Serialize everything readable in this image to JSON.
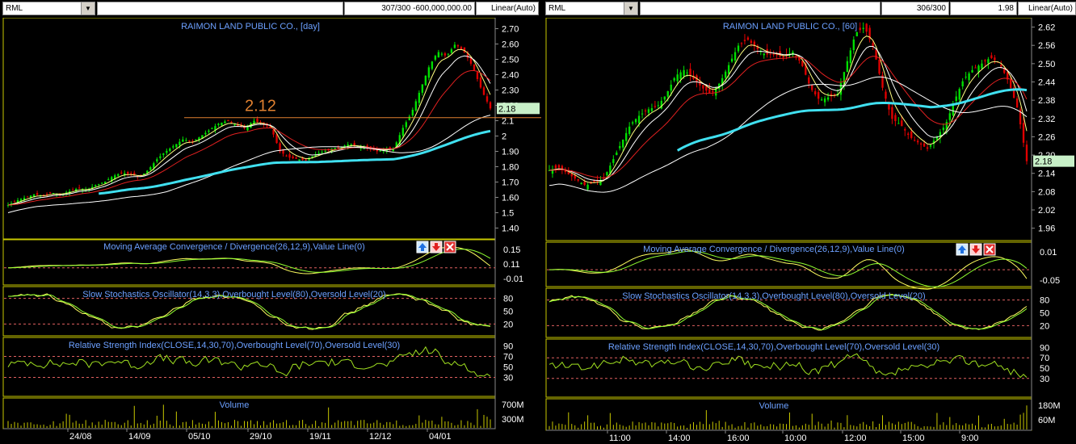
{
  "left": {
    "symbol": "RML",
    "field1": "",
    "field2": "307/300 -600,000,000.00",
    "scale": "Linear(Auto)",
    "title": "RAIMON LAND PUBLIC CO., [day]",
    "price_label": "2.18",
    "annotation": "2.12",
    "y_ticks": [
      "2.70",
      "2.60",
      "2.50",
      "2.40",
      "2.30",
      "2.20",
      "2.1",
      "2",
      "1.90",
      "1.80",
      "1.70",
      "1.60",
      "1.5",
      "1.40"
    ],
    "macd_title": "Moving Average Convergence / Divergence(26,12,9),Value Line(0)",
    "macd_ticks": [
      "0.15",
      "0.11",
      "-0.01"
    ],
    "stoch_title": "Slow Stochastics Oscillator(14,3,3),Overbought Level(80),Oversold Level(20)",
    "stoch_ticks": [
      "80",
      "50",
      "20"
    ],
    "rsi_title": "Relative Strength Index(CLOSE,14,30,70),Overbought Level(70),Oversold Level(30)",
    "rsi_ticks": [
      "90",
      "70",
      "50",
      "30"
    ],
    "volume_title": "Volume",
    "volume_ticks": [
      "700M",
      "300M"
    ],
    "x_ticks": [
      "24/08",
      "14/09",
      "05/10",
      "29/10",
      "19/11",
      "12/12",
      "04/01"
    ]
  },
  "right": {
    "symbol": "RML",
    "field1": "",
    "field2": "306/300",
    "field3": "1.98",
    "scale": "Linear(Auto)",
    "title": "RAIMON LAND PUBLIC CO., [60]",
    "price_label": "2.18",
    "y_ticks": [
      "2.62",
      "2.56",
      "2.50",
      "2.44",
      "2.38",
      "2.32",
      "2.26",
      "2.20",
      "2.14",
      "2.08",
      "2.02",
      "1.96"
    ],
    "macd_title": "Moving Average Convergence / Divergence(26,12,9),Value Line(0)",
    "macd_ticks": [
      "0.01",
      "-0.05"
    ],
    "stoch_title": "Slow Stochastics Oscillator(14,3,3),Overbought Level(80),Oversold Level(20)",
    "stoch_ticks": [
      "80",
      "50",
      "20"
    ],
    "rsi_title": "Relative Strength Index(CLOSE,14,30,70),Overbought Level(70),Oversold Level(30)",
    "rsi_ticks": [
      "90",
      "70",
      "50",
      "30"
    ],
    "volume_title": "Volume",
    "volume_ticks": [
      "180M",
      "60M"
    ],
    "x_ticks": [
      "11:00",
      "14:00",
      "16:00",
      "10:00",
      "12:00",
      "15:00",
      "9:00"
    ]
  },
  "chart_data": [
    {
      "type": "candlestick",
      "title": "RAIMON LAND PUBLIC CO., [day]",
      "y_range": [
        1.35,
        2.75
      ],
      "last_price": 2.18,
      "annotation_level": 2.12,
      "x_labels": [
        "24/08",
        "14/09",
        "05/10",
        "29/10",
        "19/11",
        "12/12",
        "04/01"
      ],
      "close_series": [
        1.55,
        1.58,
        1.6,
        1.62,
        1.61,
        1.63,
        1.62,
        1.64,
        1.66,
        1.65,
        1.68,
        1.7,
        1.74,
        1.76,
        1.75,
        1.73,
        1.78,
        1.85,
        1.9,
        1.94,
        1.98,
        1.96,
        2.0,
        2.04,
        2.08,
        2.1,
        2.07,
        2.05,
        2.1,
        2.08,
        2.05,
        1.9,
        1.86,
        1.85,
        1.84,
        1.88,
        1.9,
        1.92,
        1.93,
        1.95,
        1.93,
        1.92,
        1.9,
        1.91,
        1.92,
        2.05,
        2.15,
        2.3,
        2.45,
        2.55,
        2.52,
        2.6,
        2.55,
        2.45,
        2.3,
        2.18
      ],
      "indicators": {
        "macd_ticks": [
          0.15,
          0.11,
          -0.01
        ],
        "stochastic_levels": [
          80,
          20
        ],
        "rsi_levels": [
          70,
          30
        ]
      }
    },
    {
      "type": "candlestick",
      "title": "RAIMON LAND PUBLIC CO., [60]",
      "y_range": [
        1.93,
        2.64
      ],
      "last_price": 2.18,
      "x_labels": [
        "11:00",
        "14:00",
        "16:00",
        "10:00",
        "12:00",
        "15:00",
        "9:00"
      ],
      "close_series": [
        2.15,
        2.16,
        2.14,
        2.12,
        2.1,
        2.11,
        2.12,
        2.18,
        2.24,
        2.3,
        2.33,
        2.35,
        2.36,
        2.4,
        2.46,
        2.48,
        2.45,
        2.42,
        2.4,
        2.44,
        2.5,
        2.56,
        2.58,
        2.55,
        2.53,
        2.53,
        2.52,
        2.54,
        2.5,
        2.42,
        2.38,
        2.39,
        2.4,
        2.5,
        2.6,
        2.62,
        2.55,
        2.42,
        2.32,
        2.3,
        2.26,
        2.24,
        2.22,
        2.26,
        2.3,
        2.38,
        2.45,
        2.48,
        2.5,
        2.52,
        2.5,
        2.44,
        2.35,
        2.18
      ],
      "indicators": {
        "macd_ticks": [
          0.01,
          -0.05
        ],
        "stochastic_levels": [
          80,
          20
        ],
        "rsi_levels": [
          70,
          30
        ]
      }
    }
  ]
}
